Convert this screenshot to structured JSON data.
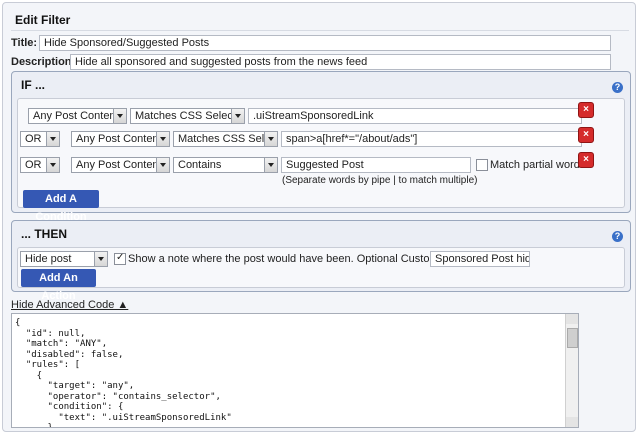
{
  "header": {
    "title": "Edit Filter"
  },
  "form": {
    "title_label": "Title:",
    "title_value": "Hide Sponsored/Suggested Posts",
    "description_label": "Description:",
    "description_value": "Hide all sponsored and suggested posts from the news feed"
  },
  "if_panel": {
    "title": "IF ...",
    "help": "?",
    "rows": [
      {
        "target": "Any Post Content",
        "operator": "Matches CSS Selector",
        "value": ".uiStreamSponsoredLink"
      },
      {
        "join": "OR",
        "target": "Any Post Content",
        "operator": "Matches CSS Selector",
        "value": "span>a[href*=\"/about/ads\"]"
      },
      {
        "join": "OR",
        "target": "Any Post Content",
        "operator": "Contains",
        "value": "Suggested Post",
        "match_partial_label": "Match partial words",
        "hint": "(Separate words by pipe | to match multiple)"
      }
    ],
    "delete": "×",
    "add_button": "Add A Condition"
  },
  "then_panel": {
    "title": "... THEN",
    "help": "?",
    "action": "Hide post",
    "show_note_label": "Show a note where the post would have been. Optional Custom Message:",
    "custom_message": "Sponsored Post hidden",
    "add_button": "Add An Action"
  },
  "advanced": {
    "toggle_label": "Hide Advanced Code ▲",
    "code": "{\n  \"id\": null,\n  \"match\": \"ANY\",\n  \"disabled\": false,\n  \"rules\": [\n    {\n      \"target\": \"any\",\n      \"operator\": \"contains_selector\",\n      \"condition\": {\n        \"text\": \".uiStreamSponsoredLink\"\n      }"
  }
}
